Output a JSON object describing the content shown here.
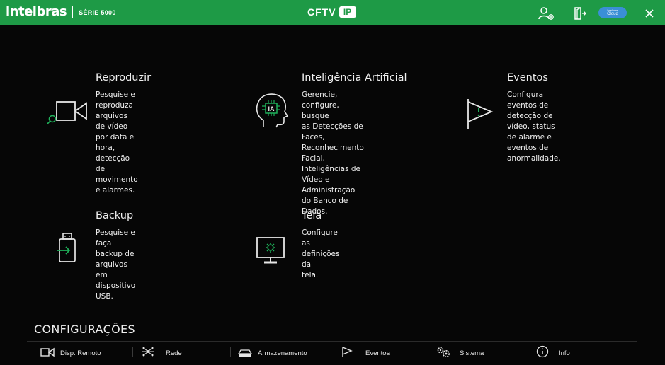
{
  "header": {
    "brand": "intelbras",
    "series": "SÉRIE 5000",
    "center_label": "CFTV",
    "center_badge": "IP",
    "cloud_line1": "Intelbras",
    "cloud_line2": "Cloud",
    "accent_color": "#1e9a46",
    "icons": [
      "user-settings-icon",
      "logout-icon",
      "intelbras-cloud-icon",
      "close-icon"
    ]
  },
  "tiles": [
    {
      "id": "reproduzir",
      "title": "Reproduzir",
      "desc": "Pesquise e reproduza\narquivos de vídeo por data e\nhora, detecção de\nmovimento e alarmes.",
      "icon": "playback-camera-icon"
    },
    {
      "id": "ia",
      "title": "Inteligência Artificial",
      "desc": "Gerencie, configure, busque\nas Detecções de Faces,\nReconhecimento Facial,\nInteligências de Vídeo e\nAdministração do Banco de\nDados.",
      "icon": "ai-head-icon",
      "icon_text": "IA"
    },
    {
      "id": "eventos",
      "title": "Eventos",
      "desc": "Configura eventos de\ndetecção de vídeo, status\nde alarme e eventos de\nanormalidade.",
      "icon": "event-flag-icon"
    },
    {
      "id": "backup",
      "title": "Backup",
      "desc": "Pesquise e faça backup de\narquivos em dispositivo\nUSB.",
      "icon": "usb-backup-icon"
    },
    {
      "id": "tela",
      "title": "Tela",
      "desc": "Configure as definições da\ntela.",
      "icon": "display-settings-icon"
    }
  ],
  "config": {
    "title": "CONFIGURAÇÕES",
    "items": [
      {
        "label": "Disp. Remoto",
        "icon": "remote-device-icon"
      },
      {
        "label": "Rede",
        "icon": "network-icon"
      },
      {
        "label": "Armazenamento",
        "icon": "storage-icon"
      },
      {
        "label": "Eventos",
        "icon": "event-flag-icon"
      },
      {
        "label": "Sistema",
        "icon": "system-gears-icon"
      },
      {
        "label": "Info",
        "icon": "info-icon"
      }
    ]
  }
}
